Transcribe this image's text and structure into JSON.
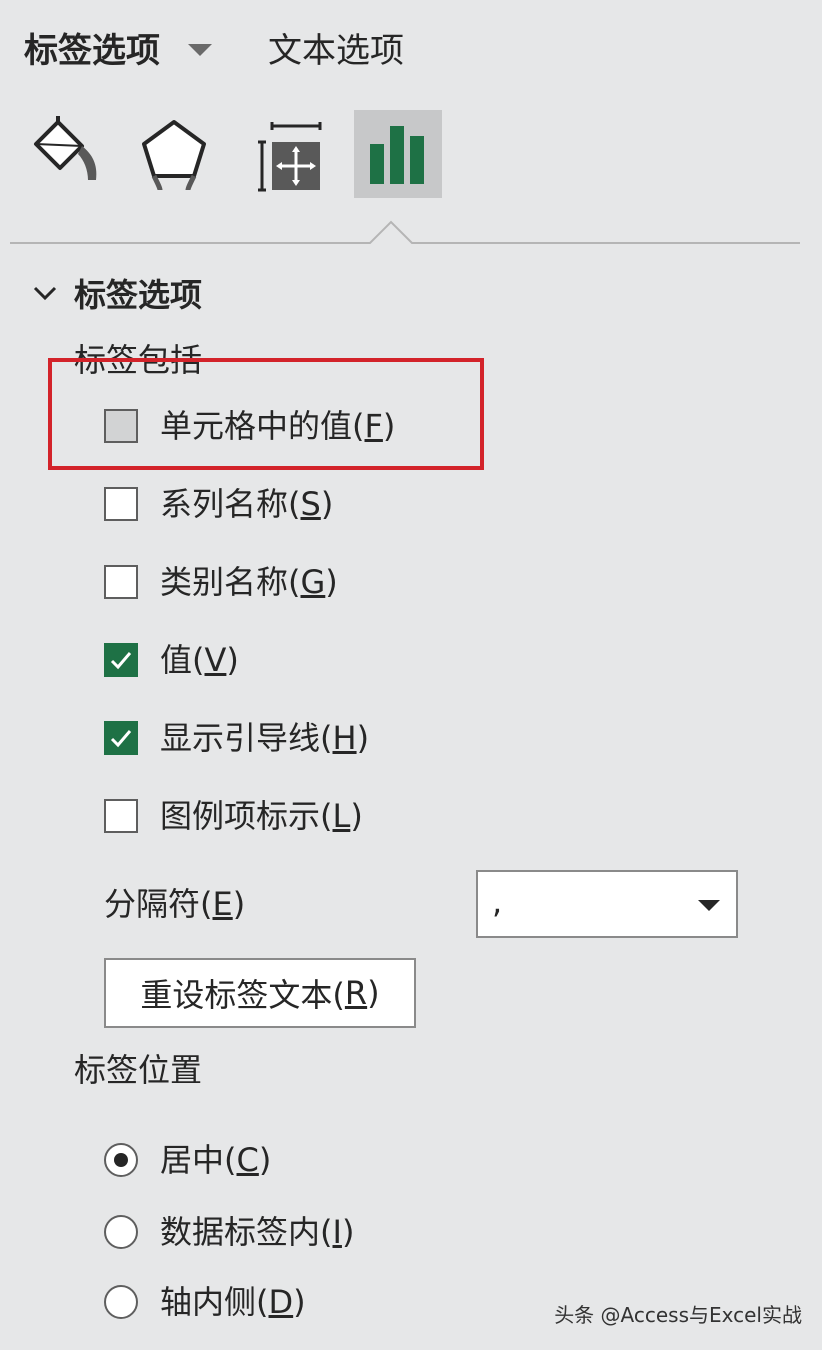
{
  "header": {
    "tab_label_options": "标签选项",
    "tab_text_options": "文本选项"
  },
  "icons": [
    "fill-line-icon",
    "effects-pentagon-icon",
    "size-properties-icon",
    "bar-chart-icon"
  ],
  "section": {
    "title": "标签选项"
  },
  "label_contains": {
    "heading": "标签包括",
    "checkboxes": [
      {
        "text": "单元格中的值(",
        "key": "F",
        "end": ")",
        "checked": false
      },
      {
        "text": "系列名称(",
        "key": "S",
        "end": ")",
        "checked": false
      },
      {
        "text": "类别名称(",
        "key": "G",
        "end": ")",
        "checked": false
      },
      {
        "text": "值(",
        "key": "V",
        "end": ")",
        "checked": true
      },
      {
        "text": "显示引导线(",
        "key": "H",
        "end": ")",
        "checked": true
      },
      {
        "text": "图例项标示(",
        "key": "L",
        "end": ")",
        "checked": false
      }
    ]
  },
  "separator": {
    "label": "分隔符(",
    "key": "E",
    "end": ")",
    "value": ","
  },
  "reset_button": {
    "text": "重设标签文本(",
    "key": "R",
    "end": ")"
  },
  "label_position": {
    "heading": "标签位置",
    "options": [
      {
        "text": "居中(",
        "key": "C",
        "end": ")",
        "selected": true
      },
      {
        "text": "数据标签内(",
        "key": "I",
        "end": ")",
        "selected": false
      },
      {
        "text": "轴内侧(",
        "key": "D",
        "end": ")",
        "selected": false
      }
    ]
  },
  "watermark": "头条 @Access与Excel实战",
  "colors": {
    "accent_green": "#1e7145",
    "highlight_red": "#d3232a",
    "panel_bg": "#e6e7e8"
  }
}
